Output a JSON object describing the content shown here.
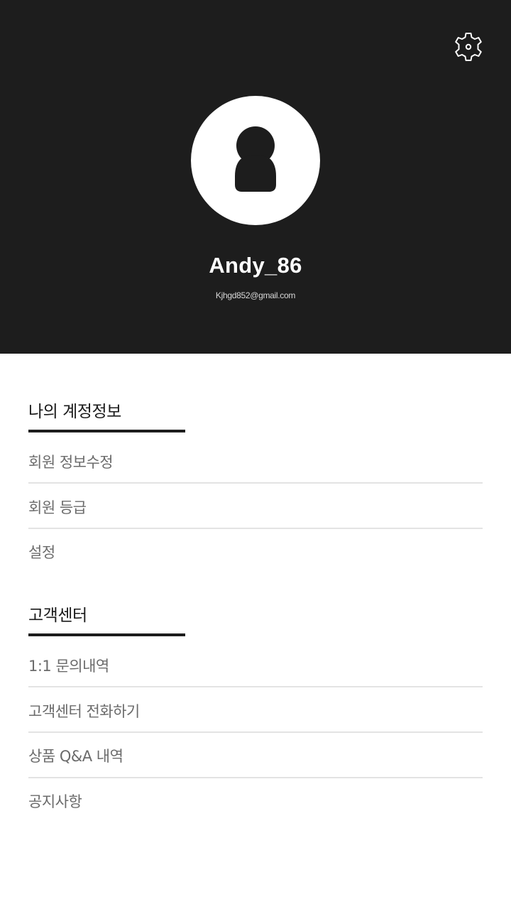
{
  "profile": {
    "username": "Andy_86",
    "email": "Kjhgd852@gmail.com"
  },
  "sections": [
    {
      "title": "나의 계정정보",
      "items": [
        "회원 정보수정",
        "회원 등급",
        "설정"
      ]
    },
    {
      "title": "고객센터",
      "items": [
        "1:1 문의내역",
        "고객센터 전화하기",
        "상품 Q&A 내역",
        "공지사항"
      ]
    }
  ],
  "icons": {
    "settings": "gear-icon",
    "avatar": "user-silhouette-icon"
  },
  "colors": {
    "header_bg": "#1d1d1d",
    "section_bar": "#1d1d1d",
    "divider": "#e3e3e3",
    "item_text": "#6b6b6b"
  }
}
